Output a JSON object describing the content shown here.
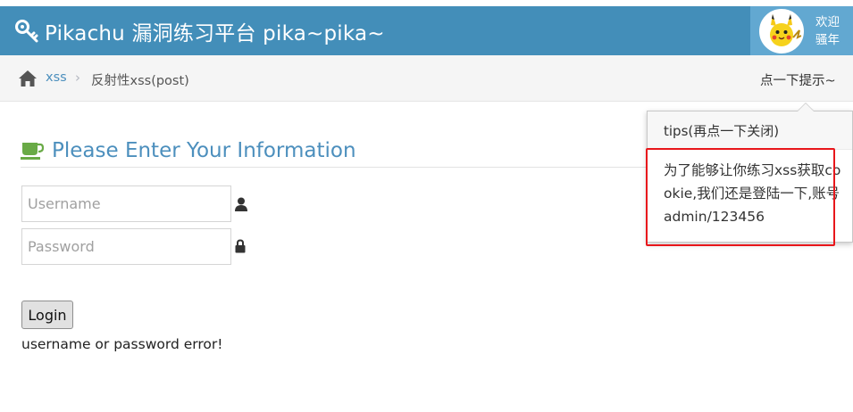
{
  "header": {
    "title": "Pikachu 漏洞练习平台 pika~pika~",
    "welcome_line1": "欢迎",
    "welcome_line2": "骚年",
    "bar_color": "#438eb9",
    "user_box_color": "#62a8d1"
  },
  "breadcrumb": {
    "home_icon": "home-icon",
    "link": "xss",
    "separator": "›",
    "current": "反射性xss(post)",
    "hint_link": "点一下提示~"
  },
  "popover": {
    "title": "tips(再点一下关闭)",
    "body": "为了能够让你练习xss获取cookie,我们还是登陆一下,账号admin/123456",
    "highlight_color": "#e8161b"
  },
  "form": {
    "heading": "Please Enter Your Information",
    "heading_icon": "coffee-cup-icon",
    "username_placeholder": "Username",
    "username_value": "",
    "password_placeholder": "Password",
    "password_value": "",
    "user_icon": "user-icon",
    "lock_icon": "lock-icon",
    "login_label": "Login",
    "error_message": "username or password error!",
    "accent_color": "#4c8fbd"
  }
}
